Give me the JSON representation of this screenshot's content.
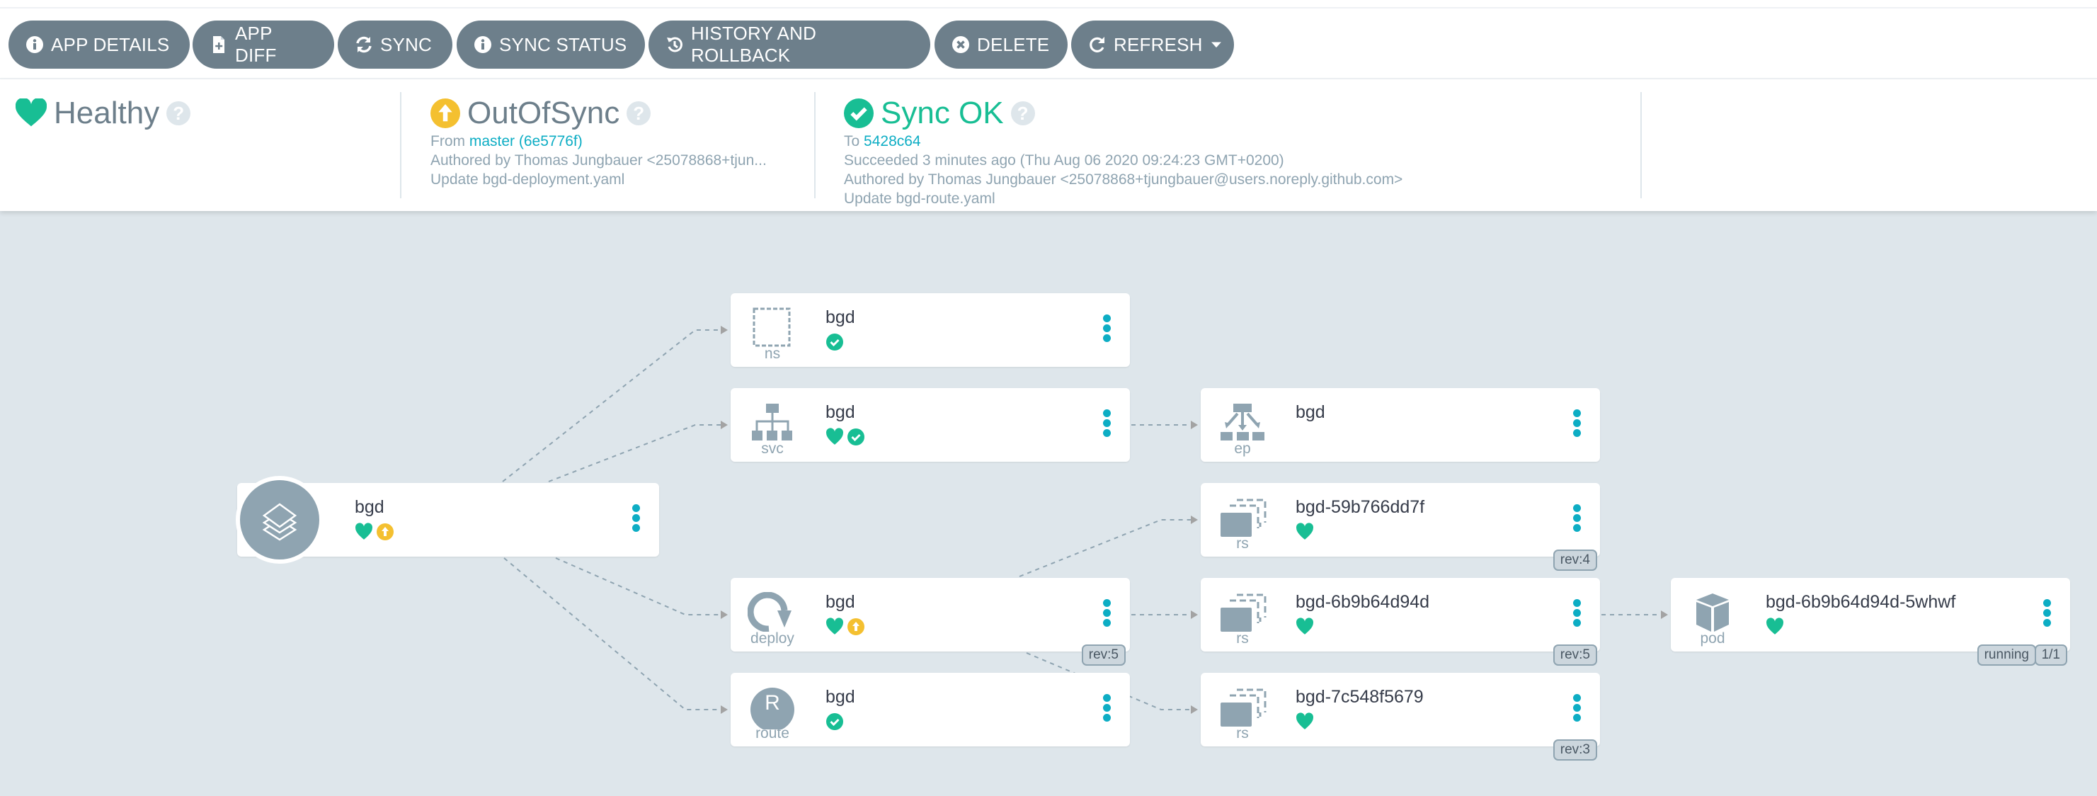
{
  "toolbar": {
    "buttons": [
      {
        "label": "APP DETAILS",
        "icon": "info-circle-icon"
      },
      {
        "label": "APP DIFF",
        "icon": "file-diff-icon"
      },
      {
        "label": "SYNC",
        "icon": "sync-icon"
      },
      {
        "label": "SYNC STATUS",
        "icon": "info-circle-icon"
      },
      {
        "label": "HISTORY AND ROLLBACK",
        "icon": "history-icon"
      },
      {
        "label": "DELETE",
        "icon": "times-circle-icon"
      },
      {
        "label": "REFRESH",
        "icon": "redo-icon",
        "dropdown": "caret-down-icon"
      }
    ]
  },
  "summary": {
    "health": {
      "label": "Healthy",
      "icon": "heart-icon",
      "color": "#18be94"
    },
    "sync": {
      "label": "OutOfSync",
      "icon": "arrow-circle-up-icon",
      "color": "#f4c030",
      "from_prefix": "From",
      "from_link": "master (6e5776f)",
      "author": "Authored by Thomas Jungbauer <25078868+tjun...",
      "message": "Update bgd-deployment.yaml"
    },
    "operation": {
      "label": "Sync OK",
      "icon": "check-circle-icon",
      "color": "#18be94",
      "to_prefix": "To",
      "to_link": "5428c64",
      "succeeded": "Succeeded 3 minutes ago (Thu Aug 06 2020 09:24:23 GMT+0200)",
      "author": "Authored by Thomas Jungbauer <25078868+tjungbauer@users.noreply.github.com>",
      "message": "Update bgd-route.yaml"
    }
  },
  "colors": {
    "healthy": "#18be94",
    "outofsync": "#f4c030",
    "accent": "#0dadc4",
    "button": "#6d7f8b",
    "canvas": "#dee6eb"
  },
  "tree": {
    "app": {
      "name": "bgd",
      "status": [
        "healthy",
        "outofsync"
      ]
    },
    "nodes": [
      {
        "id": "ns",
        "kind": "ns",
        "name": "bgd",
        "status": [
          "synced"
        ]
      },
      {
        "id": "svc",
        "kind": "svc",
        "name": "bgd",
        "status": [
          "healthy",
          "synced"
        ]
      },
      {
        "id": "deploy",
        "kind": "deploy",
        "name": "bgd",
        "status": [
          "healthy",
          "outofsync"
        ],
        "tags": [
          "rev:5"
        ]
      },
      {
        "id": "route",
        "kind": "route",
        "name": "bgd",
        "status": [
          "synced"
        ]
      },
      {
        "id": "ep",
        "kind": "ep",
        "name": "bgd",
        "status": []
      },
      {
        "id": "rs1",
        "kind": "rs",
        "name": "bgd-59b766dd7f",
        "status": [
          "healthy"
        ],
        "tags": [
          "rev:4"
        ]
      },
      {
        "id": "rs2",
        "kind": "rs",
        "name": "bgd-6b9b64d94d",
        "status": [
          "healthy"
        ],
        "tags": [
          "rev:5"
        ]
      },
      {
        "id": "rs3",
        "kind": "rs",
        "name": "bgd-7c548f5679",
        "status": [
          "healthy"
        ],
        "tags": [
          "rev:3"
        ]
      },
      {
        "id": "pod",
        "kind": "pod",
        "name": "bgd-6b9b64d94d-5whwf",
        "status": [
          "healthy"
        ],
        "tags": [
          "running",
          "1/1"
        ]
      }
    ],
    "route_icon_letter": "R"
  }
}
